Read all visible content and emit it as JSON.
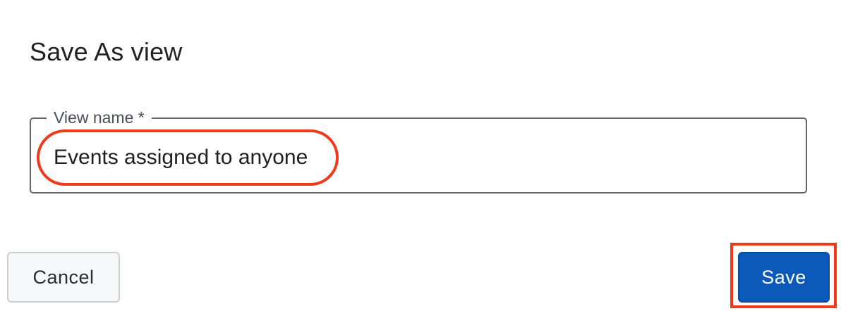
{
  "dialog": {
    "title": "Save As view"
  },
  "view_name_field": {
    "label": "View name *",
    "value": "Events assigned to anyone"
  },
  "buttons": {
    "cancel_label": "Cancel",
    "save_label": "Save"
  },
  "colors": {
    "primary": "#0b59b8",
    "annotation": "#f23a1a",
    "field_border": "#5f6670"
  }
}
